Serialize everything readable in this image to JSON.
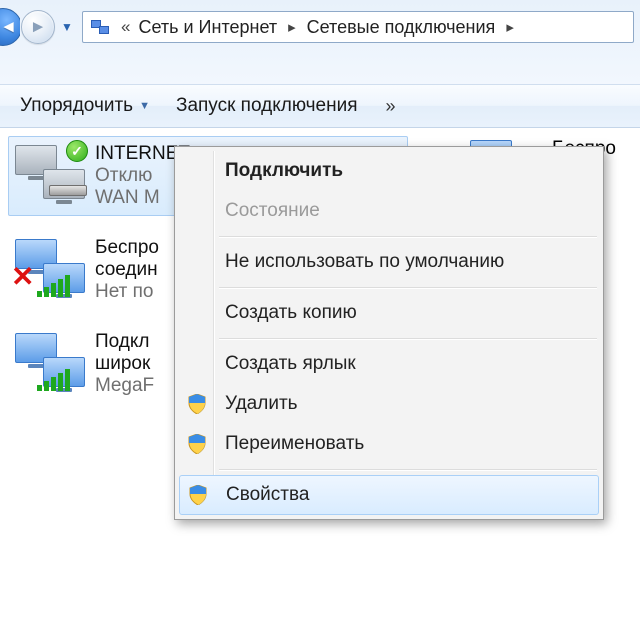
{
  "breadcrumb": {
    "parts": [
      "Сеть и Интернет",
      "Сетевые подключения"
    ]
  },
  "toolbar": {
    "organize": "Упорядочить",
    "start_connection": "Запуск подключения"
  },
  "connections": {
    "selected": {
      "title": "INTERNET",
      "status": "Отклю",
      "device": "WAN M"
    },
    "wireless": {
      "title": "Беспро",
      "line2": "соедин",
      "line3": "Нет по"
    },
    "broadband": {
      "title": "Подкл",
      "line2": "широк",
      "line3": "MegaF"
    },
    "side_wireless": {
      "title": "Беспро"
    }
  },
  "context_menu": {
    "connect": "Подключить",
    "status": "Состояние",
    "no_default": "Не использовать по умолчанию",
    "copy": "Создать копию",
    "shortcut": "Создать ярлык",
    "delete": "Удалить",
    "rename": "Переименовать",
    "properties": "Свойства"
  }
}
